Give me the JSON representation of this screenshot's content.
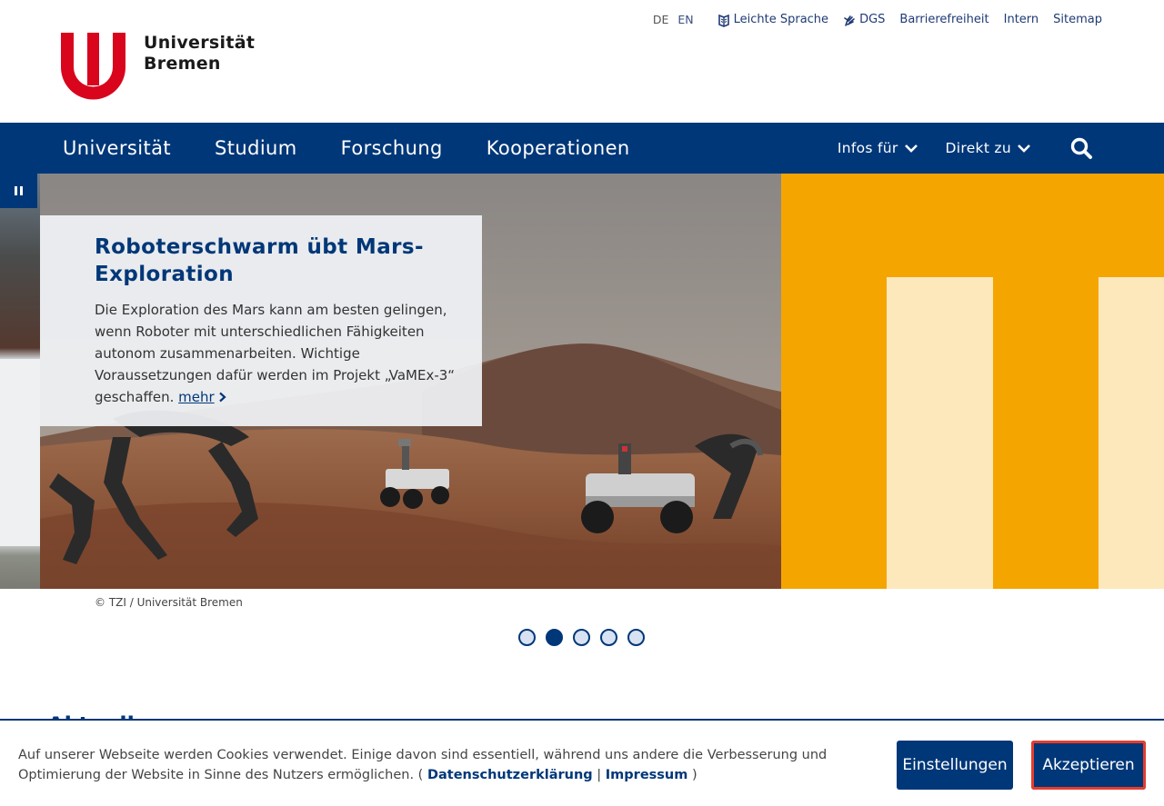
{
  "logo": {
    "line1": "Universität",
    "line2": "Bremen",
    "color": "#d9051d"
  },
  "meta_nav": {
    "lang_de": "DE",
    "lang_en": "EN",
    "links": [
      {
        "label": "Leichte Sprache",
        "icon": "book-icon"
      },
      {
        "label": "DGS",
        "icon": "sign-language-icon"
      },
      {
        "label": "Barrierefreiheit"
      },
      {
        "label": "Intern"
      },
      {
        "label": "Sitemap"
      }
    ]
  },
  "main_nav": {
    "items": [
      "Universität",
      "Studium",
      "Forschung",
      "Kooperationen"
    ],
    "infos_label": "Infos für",
    "direkt_label": "Direkt zu",
    "bg_color": "#003778"
  },
  "slider": {
    "title": "Roboterschwarm übt Mars-Exploration",
    "body": "Die Exploration des Mars kann am besten gelingen, wenn Roboter mit unterschiedlichen Fähigkeiten autonom zusammenarbeiten. Wichtige Voraussetzungen dafür werden im Projekt „VaMEx-3“ geschaffen.",
    "more_label": "mehr",
    "credit": "© TZI / Universität Bremen",
    "dot_count": 5,
    "active_dot": 2,
    "accent": "#f5a500"
  },
  "section_peek": "Aktuelles",
  "cookie": {
    "text": "Auf unserer Webseite werden Cookies verwendet. Einige davon sind essentiell, während uns andere die Verbesserung und Optimierung der Website in Sinne des Nutzers ermöglichen. (",
    "privacy_label": "Datenschutzerklärung",
    "separator": "|",
    "imprint_label": "Impressum",
    "close_paren": ")",
    "settings_label": "Einstellungen",
    "accept_label": "Akzeptieren"
  }
}
